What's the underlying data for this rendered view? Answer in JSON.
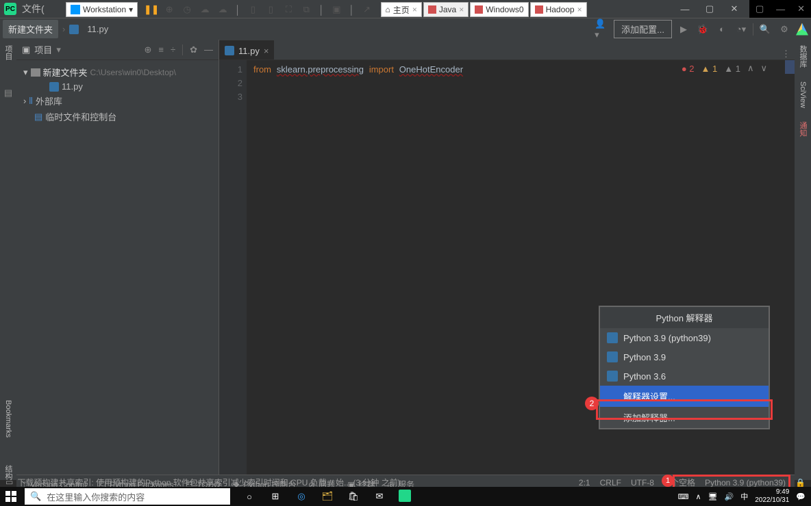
{
  "titlebar": {
    "menu_file": "文件(",
    "workstation_label": "Workstation"
  },
  "vmware_tabs": {
    "home": "主页",
    "java": "Java",
    "windows0": "Windows0",
    "hadoop": "Hadoop"
  },
  "breadcrumb": {
    "folder": "新建文件夹",
    "file": "11.py"
  },
  "navrow": {
    "add_config": "添加配置..."
  },
  "leftstrip": {
    "project": "项目",
    "bookmarks": "Bookmarks",
    "structure": "结构"
  },
  "rightstrip": {
    "database": "数据库",
    "sciview": "SciView",
    "notify": "通知"
  },
  "project_panel": {
    "title": "项目",
    "root": "新建文件夹",
    "root_path": "C:\\Users\\win0\\Desktop\\",
    "file": "11.py",
    "ext_lib": "外部库",
    "scratch": "临时文件和控制台"
  },
  "editor_tabs": {
    "tab0": "11.py"
  },
  "gutter": {
    "l1": "1",
    "l2": "2",
    "l3": "3"
  },
  "code": {
    "kw_from": "from",
    "pkg": "sklearn.preprocessing",
    "kw_import": "import",
    "sym": "OneHotEncoder"
  },
  "inspections": {
    "errors": "2",
    "warnings": "1",
    "weak": "1"
  },
  "popup": {
    "title": "Python 解释器",
    "item0": "Python 3.9 (python39)",
    "item1": "Python 3.9",
    "item2": "Python 3.6",
    "settings": "解释器设置...",
    "add": "添加解释器..."
  },
  "bottombar": {
    "vcs": "Version Control",
    "pkg": "Python Packages",
    "todo": "TODO",
    "console": "Python 控制台",
    "problems": "问题",
    "terminal": "终端",
    "services": "服务"
  },
  "statusbar": {
    "msg": "下载预构建共享索引: 使用预构建的Python 软件包共享索引减少索引时间和 CPU 负载 // 始... (3 分钟 之前)",
    "pos": "2:1",
    "crlf": "CRLF",
    "enc": "UTF-8",
    "indent": "4 个空格",
    "interpreter": "Python 3.9 (python39)"
  },
  "callouts": {
    "c1": "1",
    "c2": "2"
  },
  "taskbar": {
    "search_placeholder": "在这里输入你搜索的内容",
    "ime": "中",
    "time": "9:49",
    "date": "2022/10/31"
  }
}
